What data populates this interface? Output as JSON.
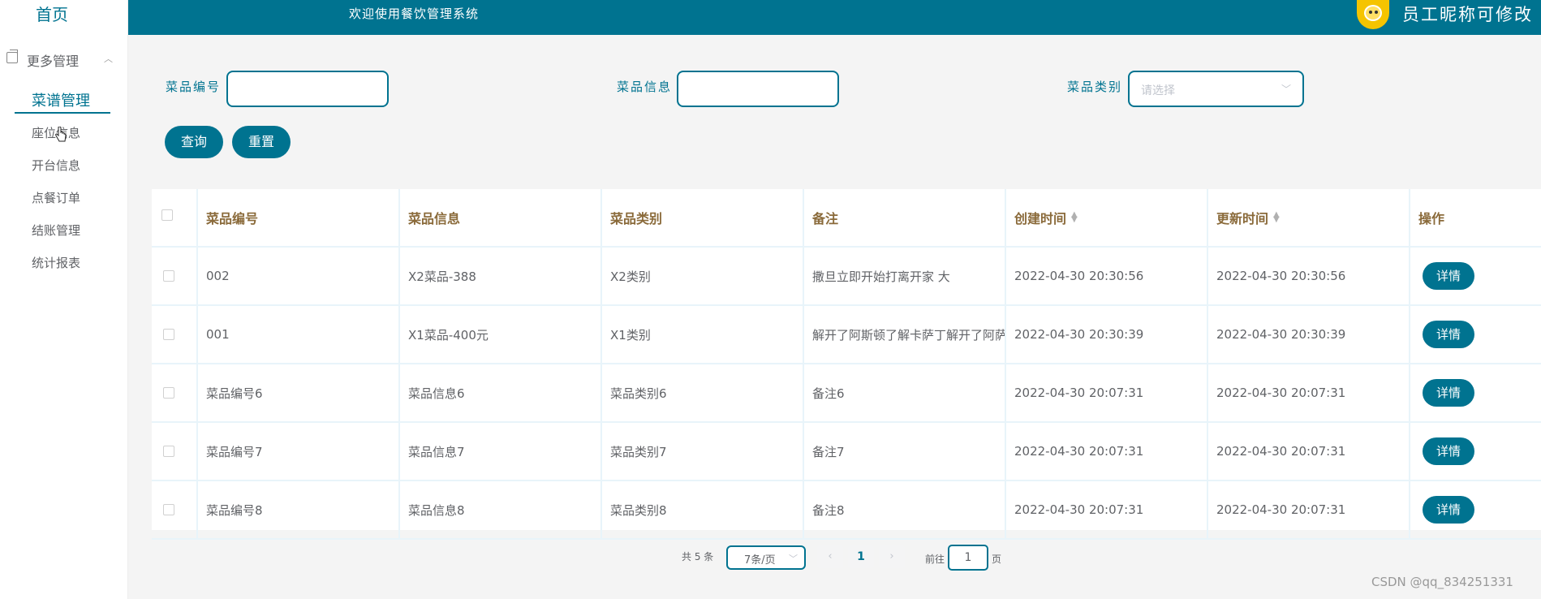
{
  "sidebar": {
    "home": "首页",
    "group": "更多管理",
    "active": "菜谱管理",
    "items": [
      "座位信息",
      "开台信息",
      "点餐订单",
      "结账管理",
      "统计报表"
    ]
  },
  "header": {
    "welcome": "欢迎使用餐饮管理系统",
    "username": "员工昵称可修改"
  },
  "search": {
    "code_label": "菜品编号",
    "info_label": "菜品信息",
    "category_label": "菜品类别",
    "category_placeholder": "请选择",
    "query_button": "查询",
    "reset_button": "重置"
  },
  "table": {
    "columns": [
      "菜品编号",
      "菜品信息",
      "菜品类别",
      "备注",
      "创建时间",
      "更新时间",
      "操作"
    ],
    "rows": [
      [
        "002",
        "X2菜品-388",
        "X2类别",
        "撒旦立即开始打离开家 大",
        "2022-04-30 20:30:56",
        "2022-04-30 20:30:56"
      ],
      [
        "001",
        "X1菜品-400元",
        "X1类别",
        "解开了阿斯顿了解卡萨丁解开了阿萨",
        "2022-04-30 20:30:39",
        "2022-04-30 20:30:39"
      ],
      [
        "菜品编号6",
        "菜品信息6",
        "菜品类别6",
        "备注6",
        "2022-04-30 20:07:31",
        "2022-04-30 20:07:31"
      ],
      [
        "菜品编号7",
        "菜品信息7",
        "菜品类别7",
        "备注7",
        "2022-04-30 20:07:31",
        "2022-04-30 20:07:31"
      ],
      [
        "菜品编号8",
        "菜品信息8",
        "菜品类别8",
        "备注8",
        "2022-04-30 20:07:31",
        "2022-04-30 20:07:31"
      ]
    ],
    "detail_button": "详情"
  },
  "pagination": {
    "total": "共 5 条",
    "page_size": "7条/页",
    "current_page": "1",
    "goto_label": "前往",
    "goto_value": "1",
    "page_suffix": "页"
  },
  "watermark": "CSDN @qq_834251331",
  "colors": {
    "primary": "#007390",
    "header_text": "#8a6a3a"
  }
}
